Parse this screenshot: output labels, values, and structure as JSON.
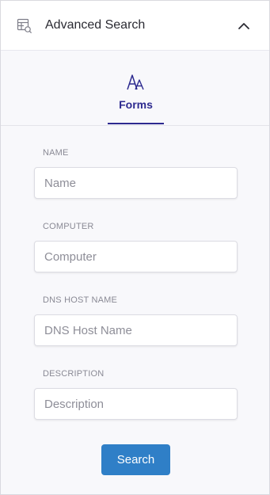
{
  "header": {
    "title": "Advanced Search",
    "icon": "table-search-icon",
    "collapse_icon": "chevron-up-icon"
  },
  "tabs": [
    {
      "label": "Forms",
      "icon": "font-size-icon",
      "active": true
    }
  ],
  "fields": [
    {
      "label": "NAME",
      "placeholder": "Name",
      "value": ""
    },
    {
      "label": "COMPUTER",
      "placeholder": "Computer",
      "value": ""
    },
    {
      "label": "DNS HOST NAME",
      "placeholder": "DNS Host Name",
      "value": ""
    },
    {
      "label": "DESCRIPTION",
      "placeholder": "Description",
      "value": ""
    }
  ],
  "actions": {
    "search_label": "Search"
  },
  "colors": {
    "accent": "#2d2a8f",
    "button": "#2f7fc7"
  }
}
